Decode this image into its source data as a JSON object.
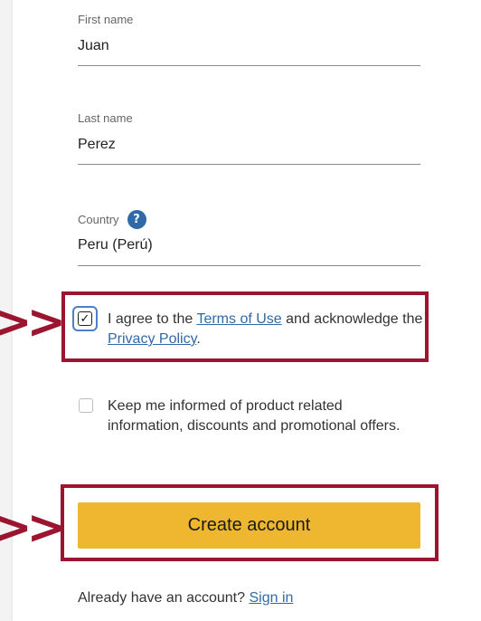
{
  "form": {
    "first_name": {
      "label": "First name",
      "value": "Juan"
    },
    "last_name": {
      "label": "Last name",
      "value": "Perez"
    },
    "country": {
      "label": "Country",
      "value": "Peru (Perú)",
      "help_glyph": "?"
    },
    "terms": {
      "checked": true,
      "checkmark": "✓",
      "text_before": "I agree to the ",
      "terms_link": "Terms of Use",
      "text_middle": " and acknowledge the ",
      "privacy_link": "Privacy Policy",
      "text_after": "."
    },
    "newsletter": {
      "checked": false,
      "text": "Keep me informed of product related information, discounts and promotional offers."
    },
    "create_button": "Create account",
    "signin": {
      "prompt": "Already have an account? ",
      "link": "Sign in"
    }
  },
  "annotations": {
    "arrow_glyph": ">>",
    "color": "#9b1530"
  },
  "colors": {
    "button": "#efb630",
    "link": "#2f6aa6",
    "help_icon": "#2f6aa6"
  }
}
